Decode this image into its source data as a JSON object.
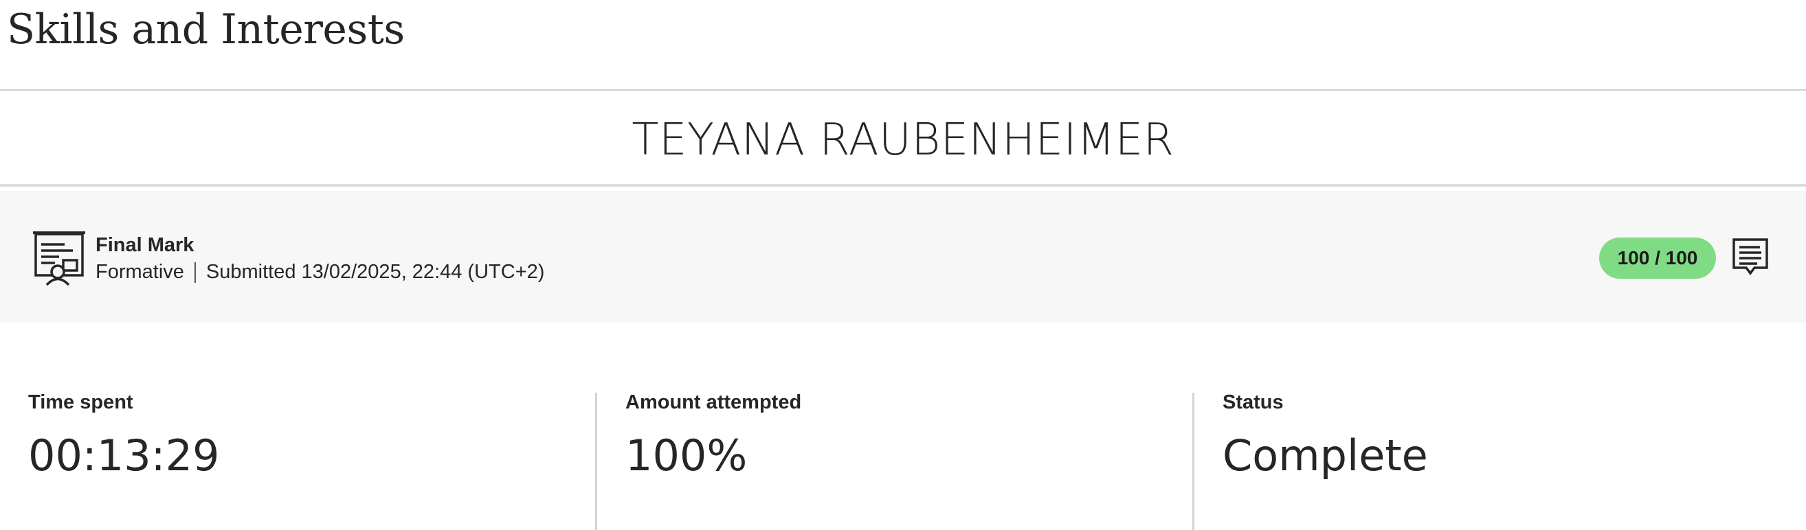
{
  "header": {
    "title": "Skills and Interests"
  },
  "student": {
    "name": "TEYANA RAUBENHEIMER"
  },
  "grade": {
    "icon": "gradebook-certificate-icon",
    "title": "Final Mark",
    "type": "Formative",
    "submitted": "Submitted 13/02/2025, 22:44 (UTC+2)",
    "score": "100 / 100",
    "score_color": "#7fdb84",
    "feedback_icon": "feedback-comment-icon"
  },
  "stats": [
    {
      "label": "Time spent",
      "value": "00:13:29"
    },
    {
      "label": "Amount attempted",
      "value": "100%"
    },
    {
      "label": "Status",
      "value": "Complete"
    }
  ]
}
